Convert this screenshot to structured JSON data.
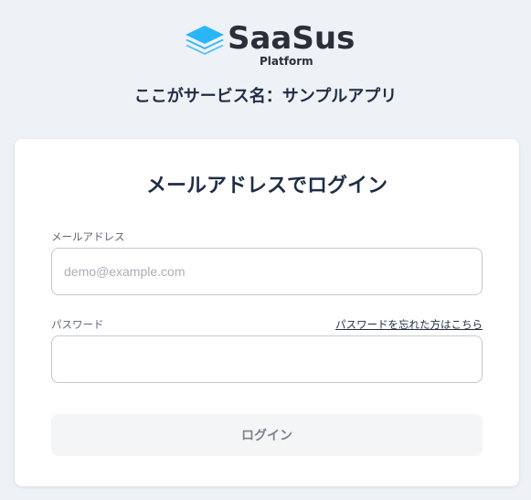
{
  "header": {
    "logo_text": "SaaSus",
    "logo_sub": "Platform",
    "service_name": "ここがサービス名：サンプルアプリ"
  },
  "login": {
    "title": "メールアドレスでログイン",
    "email_label": "メールアドレス",
    "email_placeholder": "demo@example.com",
    "email_value": "",
    "password_label": "パスワード",
    "password_value": "",
    "forgot_password_link": "パスワードを忘れた方はこちら",
    "login_button": "ログイン"
  },
  "colors": {
    "background": "#eef1f6",
    "card": "#ffffff",
    "text_primary": "#1f2d45",
    "logo_blue": "#29b6f6",
    "button_disabled_bg": "#f4f5f6",
    "button_disabled_text": "#7b8290"
  },
  "icons": {
    "logo_mark": "stacked-layers-icon"
  }
}
